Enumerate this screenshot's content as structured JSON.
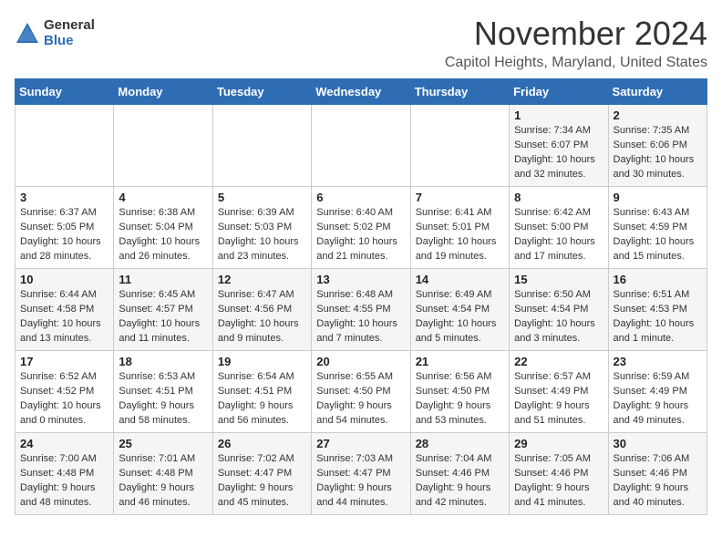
{
  "logo": {
    "general": "General",
    "blue": "Blue"
  },
  "title": "November 2024",
  "location": "Capitol Heights, Maryland, United States",
  "days_of_week": [
    "Sunday",
    "Monday",
    "Tuesday",
    "Wednesday",
    "Thursday",
    "Friday",
    "Saturday"
  ],
  "weeks": [
    [
      {
        "day": "",
        "info": ""
      },
      {
        "day": "",
        "info": ""
      },
      {
        "day": "",
        "info": ""
      },
      {
        "day": "",
        "info": ""
      },
      {
        "day": "",
        "info": ""
      },
      {
        "day": "1",
        "info": "Sunrise: 7:34 AM\nSunset: 6:07 PM\nDaylight: 10 hours and 32 minutes."
      },
      {
        "day": "2",
        "info": "Sunrise: 7:35 AM\nSunset: 6:06 PM\nDaylight: 10 hours and 30 minutes."
      }
    ],
    [
      {
        "day": "3",
        "info": "Sunrise: 6:37 AM\nSunset: 5:05 PM\nDaylight: 10 hours and 28 minutes."
      },
      {
        "day": "4",
        "info": "Sunrise: 6:38 AM\nSunset: 5:04 PM\nDaylight: 10 hours and 26 minutes."
      },
      {
        "day": "5",
        "info": "Sunrise: 6:39 AM\nSunset: 5:03 PM\nDaylight: 10 hours and 23 minutes."
      },
      {
        "day": "6",
        "info": "Sunrise: 6:40 AM\nSunset: 5:02 PM\nDaylight: 10 hours and 21 minutes."
      },
      {
        "day": "7",
        "info": "Sunrise: 6:41 AM\nSunset: 5:01 PM\nDaylight: 10 hours and 19 minutes."
      },
      {
        "day": "8",
        "info": "Sunrise: 6:42 AM\nSunset: 5:00 PM\nDaylight: 10 hours and 17 minutes."
      },
      {
        "day": "9",
        "info": "Sunrise: 6:43 AM\nSunset: 4:59 PM\nDaylight: 10 hours and 15 minutes."
      }
    ],
    [
      {
        "day": "10",
        "info": "Sunrise: 6:44 AM\nSunset: 4:58 PM\nDaylight: 10 hours and 13 minutes."
      },
      {
        "day": "11",
        "info": "Sunrise: 6:45 AM\nSunset: 4:57 PM\nDaylight: 10 hours and 11 minutes."
      },
      {
        "day": "12",
        "info": "Sunrise: 6:47 AM\nSunset: 4:56 PM\nDaylight: 10 hours and 9 minutes."
      },
      {
        "day": "13",
        "info": "Sunrise: 6:48 AM\nSunset: 4:55 PM\nDaylight: 10 hours and 7 minutes."
      },
      {
        "day": "14",
        "info": "Sunrise: 6:49 AM\nSunset: 4:54 PM\nDaylight: 10 hours and 5 minutes."
      },
      {
        "day": "15",
        "info": "Sunrise: 6:50 AM\nSunset: 4:54 PM\nDaylight: 10 hours and 3 minutes."
      },
      {
        "day": "16",
        "info": "Sunrise: 6:51 AM\nSunset: 4:53 PM\nDaylight: 10 hours and 1 minute."
      }
    ],
    [
      {
        "day": "17",
        "info": "Sunrise: 6:52 AM\nSunset: 4:52 PM\nDaylight: 10 hours and 0 minutes."
      },
      {
        "day": "18",
        "info": "Sunrise: 6:53 AM\nSunset: 4:51 PM\nDaylight: 9 hours and 58 minutes."
      },
      {
        "day": "19",
        "info": "Sunrise: 6:54 AM\nSunset: 4:51 PM\nDaylight: 9 hours and 56 minutes."
      },
      {
        "day": "20",
        "info": "Sunrise: 6:55 AM\nSunset: 4:50 PM\nDaylight: 9 hours and 54 minutes."
      },
      {
        "day": "21",
        "info": "Sunrise: 6:56 AM\nSunset: 4:50 PM\nDaylight: 9 hours and 53 minutes."
      },
      {
        "day": "22",
        "info": "Sunrise: 6:57 AM\nSunset: 4:49 PM\nDaylight: 9 hours and 51 minutes."
      },
      {
        "day": "23",
        "info": "Sunrise: 6:59 AM\nSunset: 4:49 PM\nDaylight: 9 hours and 49 minutes."
      }
    ],
    [
      {
        "day": "24",
        "info": "Sunrise: 7:00 AM\nSunset: 4:48 PM\nDaylight: 9 hours and 48 minutes."
      },
      {
        "day": "25",
        "info": "Sunrise: 7:01 AM\nSunset: 4:48 PM\nDaylight: 9 hours and 46 minutes."
      },
      {
        "day": "26",
        "info": "Sunrise: 7:02 AM\nSunset: 4:47 PM\nDaylight: 9 hours and 45 minutes."
      },
      {
        "day": "27",
        "info": "Sunrise: 7:03 AM\nSunset: 4:47 PM\nDaylight: 9 hours and 44 minutes."
      },
      {
        "day": "28",
        "info": "Sunrise: 7:04 AM\nSunset: 4:46 PM\nDaylight: 9 hours and 42 minutes."
      },
      {
        "day": "29",
        "info": "Sunrise: 7:05 AM\nSunset: 4:46 PM\nDaylight: 9 hours and 41 minutes."
      },
      {
        "day": "30",
        "info": "Sunrise: 7:06 AM\nSunset: 4:46 PM\nDaylight: 9 hours and 40 minutes."
      }
    ]
  ]
}
